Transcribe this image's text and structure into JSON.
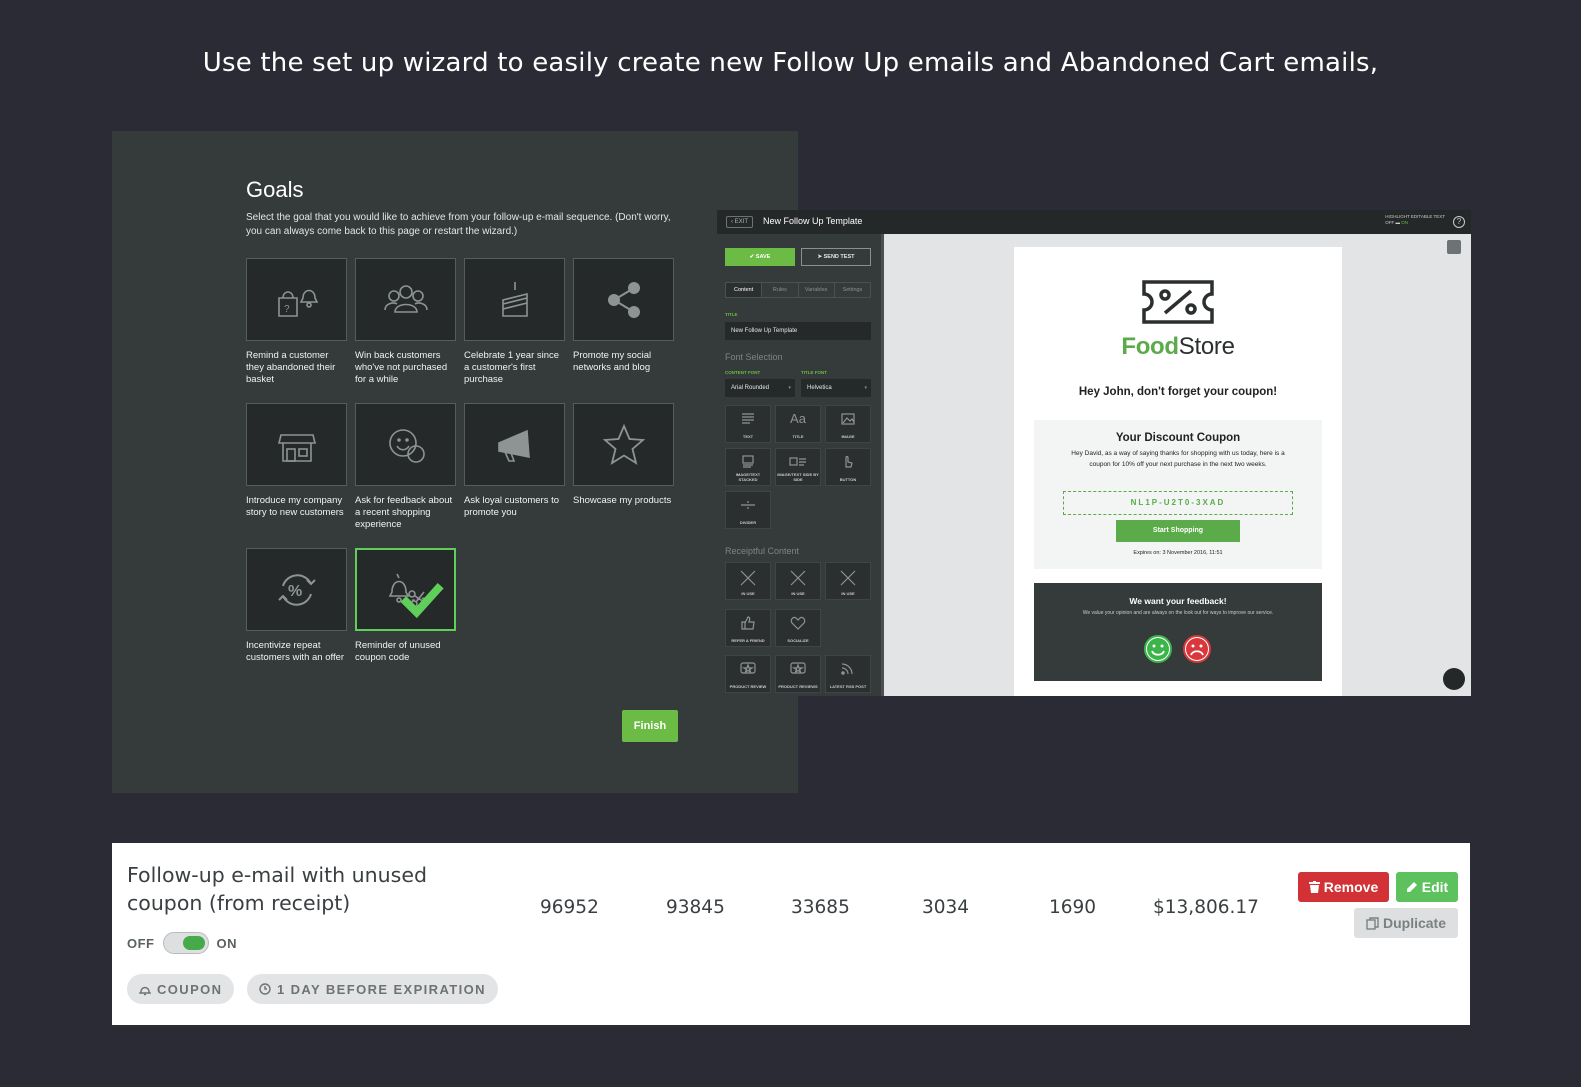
{
  "headline": "Use the set up wizard to easily create new Follow Up emails and Abandoned Cart emails,",
  "goals": {
    "title": "Goals",
    "description": "Select the goal that you would like to achieve from your follow-up e-mail sequence. (Don't worry, you can always come back to this page or restart the wizard.)",
    "items": [
      {
        "label": "Remind a customer they abandoned their basket",
        "icon": "basket-bell-icon"
      },
      {
        "label": "Win back customers who've not purchased for a while",
        "icon": "people-group-icon"
      },
      {
        "label": "Celebrate 1 year since a customer's first purchase",
        "icon": "cake-icon"
      },
      {
        "label": "Promote my social networks and blog",
        "icon": "share-icon"
      },
      {
        "label": "Introduce my company story to new customers",
        "icon": "storefront-icon"
      },
      {
        "label": "Ask for feedback about a recent shopping experience",
        "icon": "feedback-faces-icon"
      },
      {
        "label": "Ask loyal customers to promote you",
        "icon": "megaphone-icon"
      },
      {
        "label": "Showcase my products",
        "icon": "star-icon"
      },
      {
        "label": "Incentivize repeat customers with an offer",
        "icon": "percent-cycle-icon"
      },
      {
        "label": "Reminder of unused coupon code",
        "icon": "bell-scissors-icon",
        "selected": true
      }
    ],
    "finish_label": "Finish"
  },
  "editor": {
    "exit_label": "EXIT",
    "title": "New Follow Up Template",
    "highlight_label": "HIGHLIGHT EDITABLE TEXT",
    "highlight_off": "OFF",
    "highlight_on": "ON",
    "help": "?",
    "save_label": "SAVE",
    "send_test_label": "SEND TEST",
    "tabs": [
      "Content",
      "Rules",
      "Variables",
      "Settings"
    ],
    "title_field_label": "TITLE",
    "title_field_value": "New Follow Up Template",
    "font_section": "Font Selection",
    "content_font_label": "CONTENT FONT",
    "content_font_value": "Arial Rounded",
    "title_font_label": "TITLE FONT",
    "title_font_value": "Helvetica",
    "blocks": [
      "TEXT",
      "TITLE",
      "IMAGE",
      "IMAGE/TEXT STACKED",
      "IMAGE/TEXT SIDE BY SIDE",
      "BUTTON",
      "DIVIDER"
    ],
    "receiptful_section": "Receiptful Content",
    "receipt_blocks": [
      "IN USE",
      "IN USE",
      "IN USE",
      "REFER A FRIEND",
      "SOCIALIZE",
      "PRODUCT REVIEW",
      "PRODUCT REVIEWS",
      "LATEST RSS POST"
    ],
    "preview": {
      "brand_first": "Food",
      "brand_second": "Store",
      "greeting": "Hey John, don't forget your coupon!",
      "coupon_title": "Your Discount Coupon",
      "coupon_text": "Hey David, as a way of saying thanks for shopping with us today, here is a coupon for 10% off your next purchase in the next two weeks.",
      "coupon_code": "NL1P-U2T0-3XAD",
      "shop_button": "Start Shopping",
      "expires": "Expires on: 3 November 2016, 11:51",
      "feedback_title": "We want your feedback!",
      "feedback_text": "We value your opinion and are always on the look out for ways to improve our service."
    }
  },
  "list_item": {
    "title": "Follow-up e-mail with unused coupon (from receipt)",
    "toggle_off": "OFF",
    "toggle_on": "ON",
    "stats": [
      "96952",
      "93845",
      "33685",
      "3034",
      "1690",
      "$13,806.17"
    ],
    "tags": [
      "COUPON",
      "1 DAY BEFORE EXPIRATION"
    ],
    "remove_label": "Remove",
    "edit_label": "Edit",
    "duplicate_label": "Duplicate"
  },
  "colors": {
    "background": "#2b2b36",
    "panel": "#353a3b",
    "accent_green": "#6cbb45",
    "remove_red": "#d23236"
  }
}
